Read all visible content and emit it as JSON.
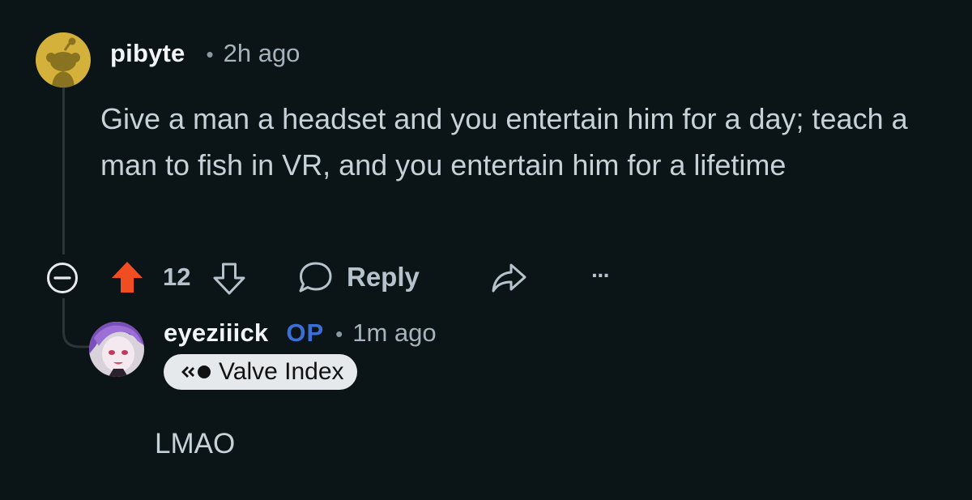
{
  "comment": {
    "author": "pibyte",
    "separator": "•",
    "time": "2h ago",
    "body": "Give a man a headset and you entertain him for a day; teach a man to fish in VR, and you entertain him for a lifetime",
    "avatar_icon": "reddit-snoo-avatar",
    "actions": {
      "collapse_icon": "collapse-minus-icon",
      "upvote_icon": "upvote-arrow-icon",
      "upvote_active_color": "#f04d23",
      "score": "12",
      "downvote_icon": "downvote-arrow-icon",
      "reply_icon": "speech-bubble-icon",
      "reply_label": "Reply",
      "share_icon": "share-arrow-icon",
      "more_label": "···"
    }
  },
  "reply": {
    "author": "eyeziiick",
    "op_badge": "OP",
    "separator": "•",
    "time": "1m ago",
    "flair": "Valve Index",
    "flair_icon": "valve-logo-icon",
    "body": "LMAO",
    "avatar_icon": "anime-character-avatar"
  },
  "colors": {
    "background": "#0b1416",
    "op_badge": "#3b6fd8",
    "upvote": "#f04d23",
    "avatar_yellow": "#d4b13a"
  }
}
